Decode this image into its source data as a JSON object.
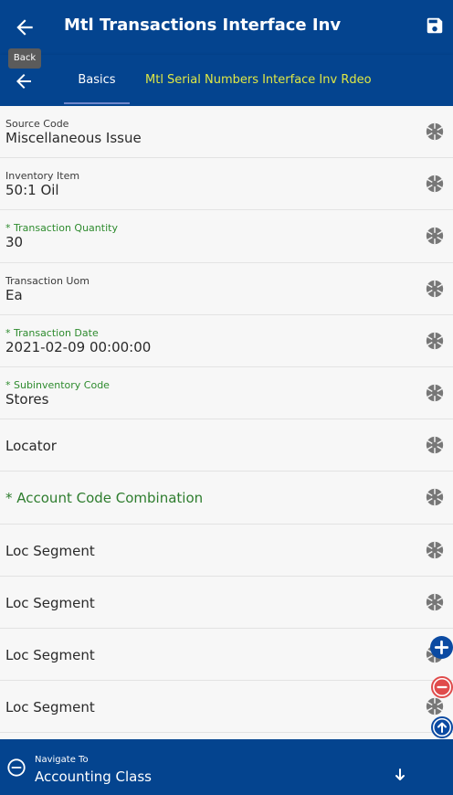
{
  "header": {
    "title": "Mtl Transactions Interface Inv"
  },
  "tooltip": {
    "text": "Back"
  },
  "tabs": [
    {
      "label": "Basics",
      "active": true
    },
    {
      "label": "Mtl Serial Numbers Interface Inv Rdeo",
      "active": false
    }
  ],
  "fields": [
    {
      "label": "Source Code",
      "value": "Miscellaneous Issue",
      "required": false
    },
    {
      "label": "Inventory Item",
      "value": "50:1 Oil",
      "required": false
    },
    {
      "label": "* Transaction Quantity",
      "value": "30",
      "required": true
    },
    {
      "label": "Transaction Uom",
      "value": "Ea",
      "required": false
    },
    {
      "label": "* Transaction Date",
      "value": "2021-02-09 00:00:00",
      "required": true
    },
    {
      "label": "* Subinventory Code",
      "value": "Stores",
      "required": true
    },
    {
      "label": "Locator",
      "value": "",
      "required": false
    },
    {
      "label": "* Account Code Combination",
      "value": "",
      "required": true
    },
    {
      "label": "Loc Segment",
      "value": "",
      "required": false
    },
    {
      "label": "Loc Segment",
      "value": "",
      "required": false
    },
    {
      "label": "Loc Segment",
      "value": "",
      "required": false
    },
    {
      "label": "Loc Segment",
      "value": "",
      "required": false
    }
  ],
  "footer": {
    "small_label": "Navigate To",
    "value": "Accounting Class"
  },
  "colors": {
    "primary": "#04448f",
    "tab_highlight": "#e0e844",
    "required": "#2e8b2e",
    "remove": "#e04b4b"
  }
}
